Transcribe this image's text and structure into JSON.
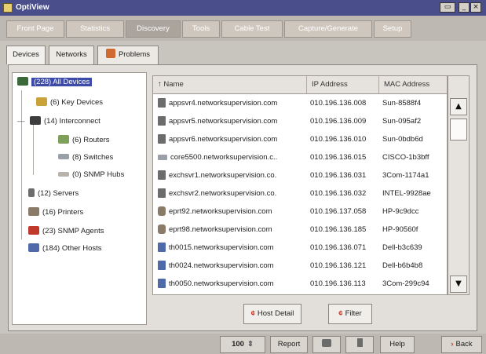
{
  "window": {
    "title": "OptiView"
  },
  "main_tabs": [
    {
      "label": "Front Page",
      "active": false
    },
    {
      "label": "Statistics",
      "active": false
    },
    {
      "label": "Discovery",
      "active": true
    },
    {
      "label": "Tools",
      "active": false
    },
    {
      "label": "Cable Test",
      "active": false
    },
    {
      "label": "Capture/Generate",
      "active": false
    },
    {
      "label": "Setup",
      "active": false
    }
  ],
  "sub_tabs": [
    {
      "label": "Devices",
      "active": true
    },
    {
      "label": "Networks",
      "active": false
    },
    {
      "label": "Problems",
      "active": false
    }
  ],
  "tree": [
    {
      "label": "(228) All Devices",
      "icon": "network-icon",
      "selected": true
    },
    {
      "label": "(6)  Key Devices",
      "icon": "key-icon"
    },
    {
      "label": "(14) Interconnect",
      "icon": "interconnect-icon",
      "expand": "—"
    },
    {
      "label": "(6)  Routers",
      "icon": "router-icon"
    },
    {
      "label": "(8)  Switches",
      "icon": "switch-icon"
    },
    {
      "label": "(0)  SNMP Hubs",
      "icon": "hub-icon"
    },
    {
      "label": "(12) Servers",
      "icon": "server-icon"
    },
    {
      "label": "(16) Printers",
      "icon": "printer-icon"
    },
    {
      "label": "(23) SNMP Agents",
      "icon": "snmp-agent-icon"
    },
    {
      "label": "(184) Other Hosts",
      "icon": "host-icon"
    }
  ],
  "table": {
    "columns": [
      "↑ Name",
      "IP Address",
      "MAC Address"
    ],
    "rows": [
      {
        "icon": "server-icon",
        "name": "appsvr4.networksupervision.com",
        "ip": "010.196.136.008",
        "mac": "Sun-8588f4"
      },
      {
        "icon": "server-icon",
        "name": "appsvr5.networksupervision.com",
        "ip": "010.196.136.009",
        "mac": "Sun-095af2"
      },
      {
        "icon": "server-icon",
        "name": "appsvr6.networksupervision.com",
        "ip": "010.196.136.010",
        "mac": "Sun-0bdb6d"
      },
      {
        "icon": "switch-icon",
        "name": "core5500.networksupervision.c..",
        "ip": "010.196.136.015",
        "mac": "CISCO-1b3bff"
      },
      {
        "icon": "server-icon",
        "name": "exchsvr1.networksupervision.co.",
        "ip": "010.196.136.031",
        "mac": "3Com-1174a1"
      },
      {
        "icon": "server-icon",
        "name": "exchsvr2.networksupervision.co.",
        "ip": "010.196.136.032",
        "mac": "INTEL-9928ae"
      },
      {
        "icon": "printer-icon",
        "name": "eprt92.networksupervision.com",
        "ip": "010.196.137.058",
        "mac": "HP-9c9dcc"
      },
      {
        "icon": "printer-icon",
        "name": "eprt98.networksupervision.com",
        "ip": "010.196.136.185",
        "mac": "HP-90560f"
      },
      {
        "icon": "workstation-icon",
        "name": "th0015.networksupervision.com",
        "ip": "010.196.136.071",
        "mac": "Dell-b3c639"
      },
      {
        "icon": "workstation-icon",
        "name": "th0024.networksupervision.com",
        "ip": "010.196.136.121",
        "mac": "Dell-b6b4b8"
      },
      {
        "icon": "workstation-icon",
        "name": "th0050.networksupervision.com",
        "ip": "010.196.136.113",
        "mac": "3Com-299c94"
      }
    ]
  },
  "actions": {
    "host_detail": "Host Detail",
    "filter": "Filter"
  },
  "statusbar": {
    "zoom": "100",
    "report": "Report",
    "help": "Help",
    "back": "Back"
  }
}
